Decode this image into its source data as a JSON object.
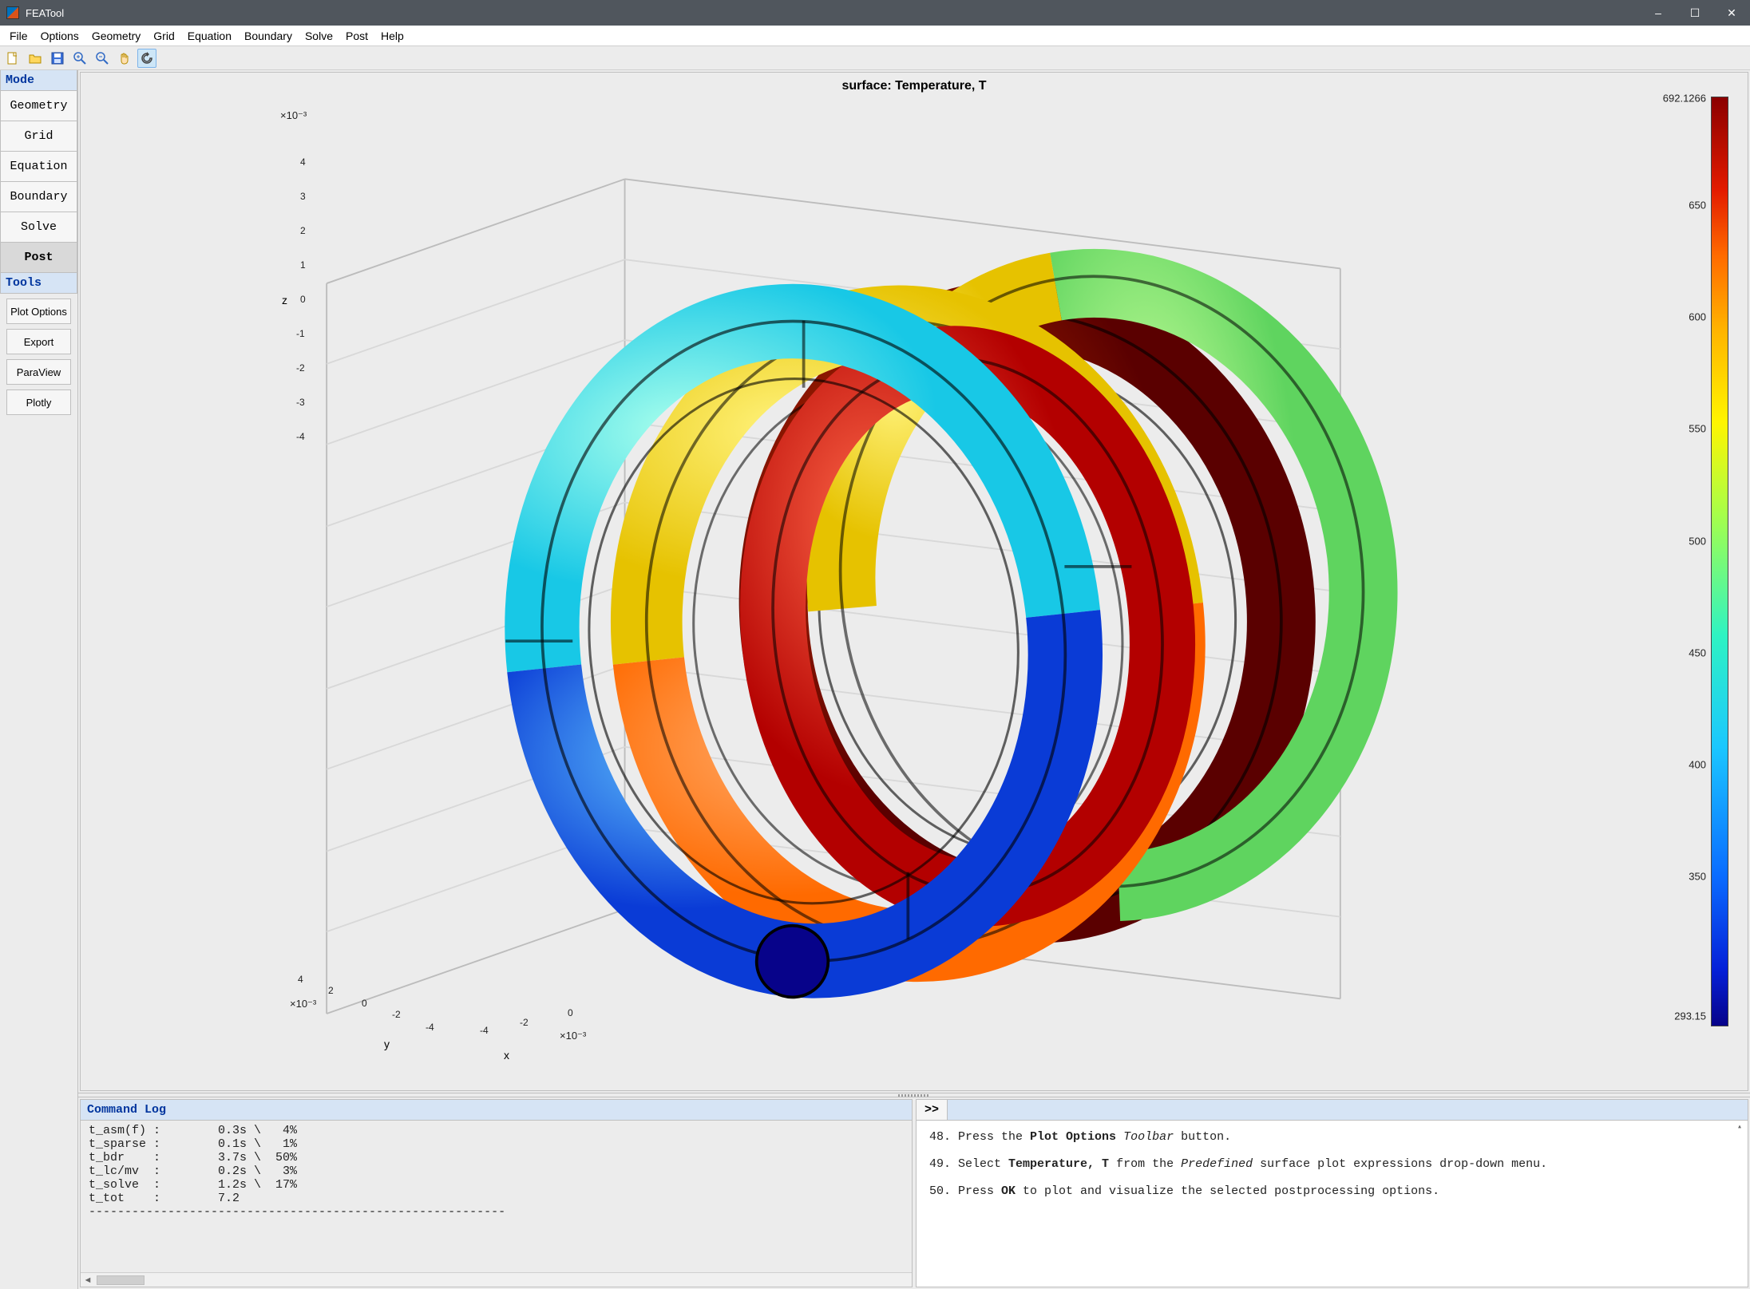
{
  "window": {
    "title": "FEATool",
    "min_label": "–",
    "max_label": "☐",
    "close_label": "✕"
  },
  "menu": [
    "File",
    "Options",
    "Geometry",
    "Grid",
    "Equation",
    "Boundary",
    "Solve",
    "Post",
    "Help"
  ],
  "toolbar_icons": [
    "new-file-icon",
    "open-folder-icon",
    "save-icon",
    "zoom-in-icon",
    "zoom-out-icon",
    "pan-hand-icon",
    "reset-view-icon"
  ],
  "sidebar": {
    "mode_header": "Mode",
    "modes": [
      "Geometry",
      "Grid",
      "Equation",
      "Boundary",
      "Solve",
      "Post"
    ],
    "active_mode_index": 5,
    "tools_header": "Tools",
    "tools": [
      "Plot Options",
      "Export",
      "ParaView",
      "Plotly"
    ]
  },
  "plot": {
    "title": "surface: Temperature, T",
    "z_axis_sci": "×10⁻³",
    "y_axis_sci": "×10⁻³",
    "x_axis_sci": "×10⁻³",
    "z_label": "z",
    "y_label": "y",
    "x_label": "x",
    "z_ticks": [
      "4",
      "3",
      "2",
      "1",
      "0",
      "-1",
      "-2",
      "-3",
      "-4"
    ],
    "y_ticks": [
      "4",
      "2",
      "0",
      "-2",
      "-4"
    ],
    "x_ticks": [
      "0",
      "-2",
      "-4"
    ]
  },
  "colorbar": {
    "max": "692.1266",
    "min": "293.15",
    "ticks": [
      "650",
      "600",
      "550",
      "500",
      "450",
      "400",
      "350"
    ]
  },
  "cmdlog": {
    "header": "Command Log",
    "lines": [
      "t_asm(f) :        0.3s \\   4%",
      "t_sparse :        0.1s \\   1%",
      "t_bdr    :        3.7s \\  50%",
      "t_lc/mv  :        0.2s \\   3%",
      "t_solve  :        1.2s \\  17%",
      "t_tot    :        7.2",
      "----------------------------------------------------------"
    ]
  },
  "instructions": {
    "prompt": ">>",
    "step48_pre": "48. Press the ",
    "step48_b1": "Plot Options",
    "step48_mid": " ",
    "step48_i1": "Toolbar",
    "step48_post": " button.",
    "step49_pre": "49. Select ",
    "step49_b1": "Temperature, T",
    "step49_mid": " from the ",
    "step49_i1": "Predefined",
    "step49_post": " surface plot expressions drop-down menu.",
    "step50_pre": "50. Press ",
    "step50_b1": "OK",
    "step50_post": " to plot and visualize the selected postprocessing options."
  },
  "chart_data": {
    "type": "surface-3d",
    "title": "surface: Temperature, T",
    "description": "3D helical coil (three turns) colored by temperature field T",
    "axes": {
      "x": {
        "label": "x",
        "scale": 0.001,
        "range": [
          -5,
          1
        ],
        "ticks": [
          -4,
          -2,
          0
        ]
      },
      "y": {
        "label": "y",
        "scale": 0.001,
        "range": [
          -5,
          5
        ],
        "ticks": [
          -4,
          -2,
          0,
          2,
          4
        ]
      },
      "z": {
        "label": "z",
        "scale": 0.001,
        "range": [
          -5,
          5
        ],
        "ticks": [
          -4,
          -3,
          -2,
          -1,
          0,
          1,
          2,
          3,
          4
        ]
      }
    },
    "colormap": "jet",
    "color_field": "Temperature, T",
    "color_range": [
      293.15,
      692.1266
    ],
    "color_ticks": [
      293.15,
      350,
      400,
      450,
      500,
      550,
      600,
      650,
      692.1266
    ],
    "turns_estimated_T_range": [
      {
        "turn": "outer-front (blue/navy)",
        "T_approx": [
          293,
          420
        ]
      },
      {
        "turn": "middle (orange/red)",
        "T_approx": [
          520,
          640
        ]
      },
      {
        "turn": "inner-back (dark red)",
        "T_approx": [
          640,
          692
        ]
      },
      {
        "turn": "outer-back (green/yellow)",
        "T_approx": [
          450,
          560
        ]
      }
    ]
  }
}
